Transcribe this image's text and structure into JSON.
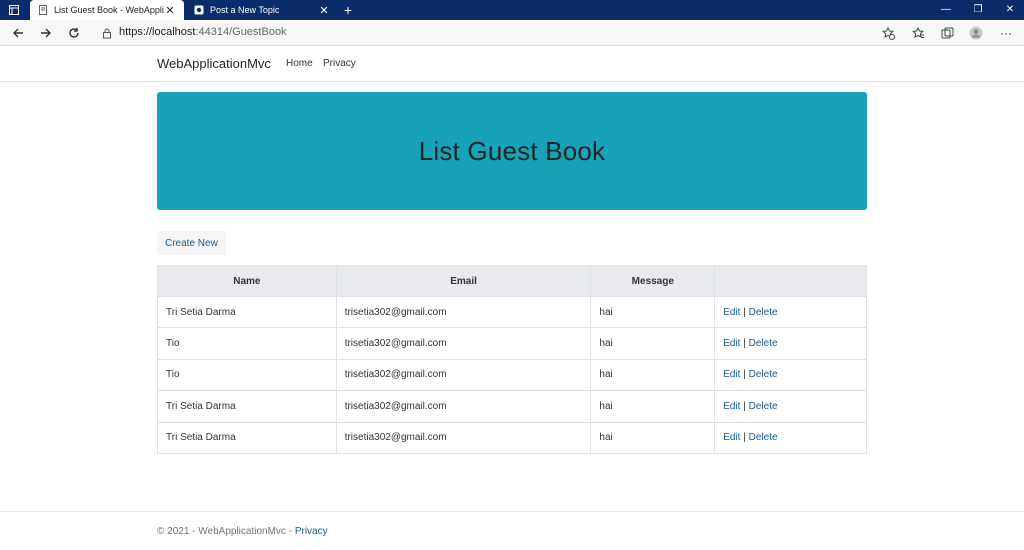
{
  "browser": {
    "tabs": [
      {
        "title": "List Guest Book - WebApplication",
        "close": "✕"
      },
      {
        "title": "Post a New Topic",
        "close": "✕"
      }
    ],
    "new_tab": "+",
    "window_controls": {
      "minimize": "—",
      "restore": "❐",
      "close": "✕"
    },
    "url_host": "https://localhost",
    "url_rest": ":44314/GuestBook",
    "more": "···"
  },
  "app": {
    "brand": "WebApplicationMvc",
    "nav": [
      "Home",
      "Privacy"
    ]
  },
  "main": {
    "heading": "List Guest Book",
    "create_label": "Create New",
    "table": {
      "headers": [
        "Name",
        "Email",
        "Message",
        ""
      ],
      "rows": [
        {
          "name": "Tri Setia Darma",
          "email": "trisetia302@gmail.com",
          "message": "hai"
        },
        {
          "name": "Tio",
          "email": "trisetia302@gmail.com",
          "message": "hai"
        },
        {
          "name": "Tio",
          "email": "trisetia302@gmail.com",
          "message": "hai"
        },
        {
          "name": "Tri Setia Darma",
          "email": "trisetia302@gmail.com",
          "message": "hai"
        },
        {
          "name": "Tri Setia Darma",
          "email": "trisetia302@gmail.com",
          "message": "hai"
        }
      ],
      "edit_label": "Edit",
      "separator": "|",
      "delete_label": "Delete"
    }
  },
  "footer": {
    "text": "© 2021 - WebApplicationMvc - ",
    "privacy": "Privacy"
  },
  "colors": {
    "titlebar": "#0b2c6b",
    "jumbotron": "#17a2b8",
    "link": "#1a5c8f"
  }
}
